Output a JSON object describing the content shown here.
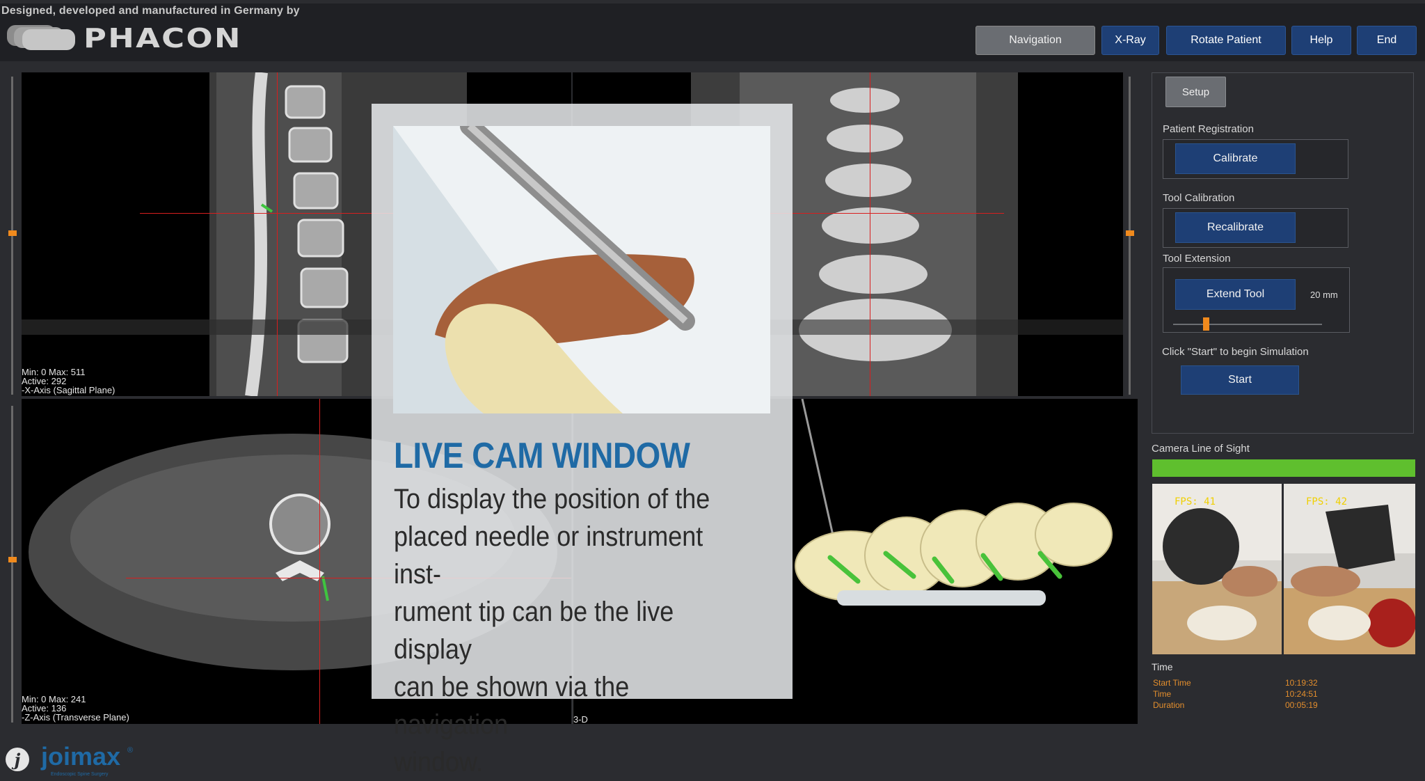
{
  "header": {
    "tagline": "Designed, developed and manufactured in Germany by",
    "brand": "PHACON",
    "nav": [
      {
        "label": "Navigation",
        "active": true
      },
      {
        "label": "X-Ray"
      },
      {
        "label": "Rotate Patient"
      },
      {
        "label": "Help"
      },
      {
        "label": "End"
      }
    ]
  },
  "views": {
    "sagittal": {
      "minmax": "Min: 0 Max: 511",
      "active": "Active: 292",
      "axis": "-X-Axis (Sagittal Plane)"
    },
    "transverse": {
      "minmax": "Min: 0 Max: 241",
      "active": "Active: 136",
      "axis": "-Z-Axis (Transverse Plane)"
    },
    "threed": {
      "label": "3-D"
    }
  },
  "panel": {
    "setup": "Setup",
    "patient_registration": "Patient Registration",
    "calibrate": "Calibrate",
    "tool_calibration": "Tool Calibration",
    "recalibrate": "Recalibrate",
    "tool_extension": "Tool Extension",
    "extend_tool": "Extend Tool",
    "extension_value": "20 mm",
    "extension_fraction": 0.22,
    "start_hint": "Click \"Start\" to begin Simulation",
    "start": "Start"
  },
  "camera": {
    "label": "Camera Line of Sight",
    "fps_left": "FPS: 41",
    "fps_right": "FPS: 42",
    "status_color": "#5fbf2e"
  },
  "time": {
    "title": "Time",
    "rows": [
      {
        "label": "Start Time",
        "value": "10:19:32"
      },
      {
        "label": "Time",
        "value": "10:24:51"
      },
      {
        "label": "Duration",
        "value": "00:05:19"
      }
    ]
  },
  "overlay": {
    "title": "LIVE CAM WINDOW",
    "desc_lines": [
      "To display the position of the",
      "placed needle or instrument inst-",
      "rument tip can be the live display",
      "can be shown via the navigation",
      "window."
    ]
  },
  "footer": {
    "brand": "joimax",
    "registered": "®",
    "tagline": "Endoscopic Spine Surgery"
  },
  "colors": {
    "accent_blue": "#1e3f75",
    "title_blue": "#1f6aa5",
    "orange": "#f08a1d",
    "crosshair": "#d81e1e"
  }
}
